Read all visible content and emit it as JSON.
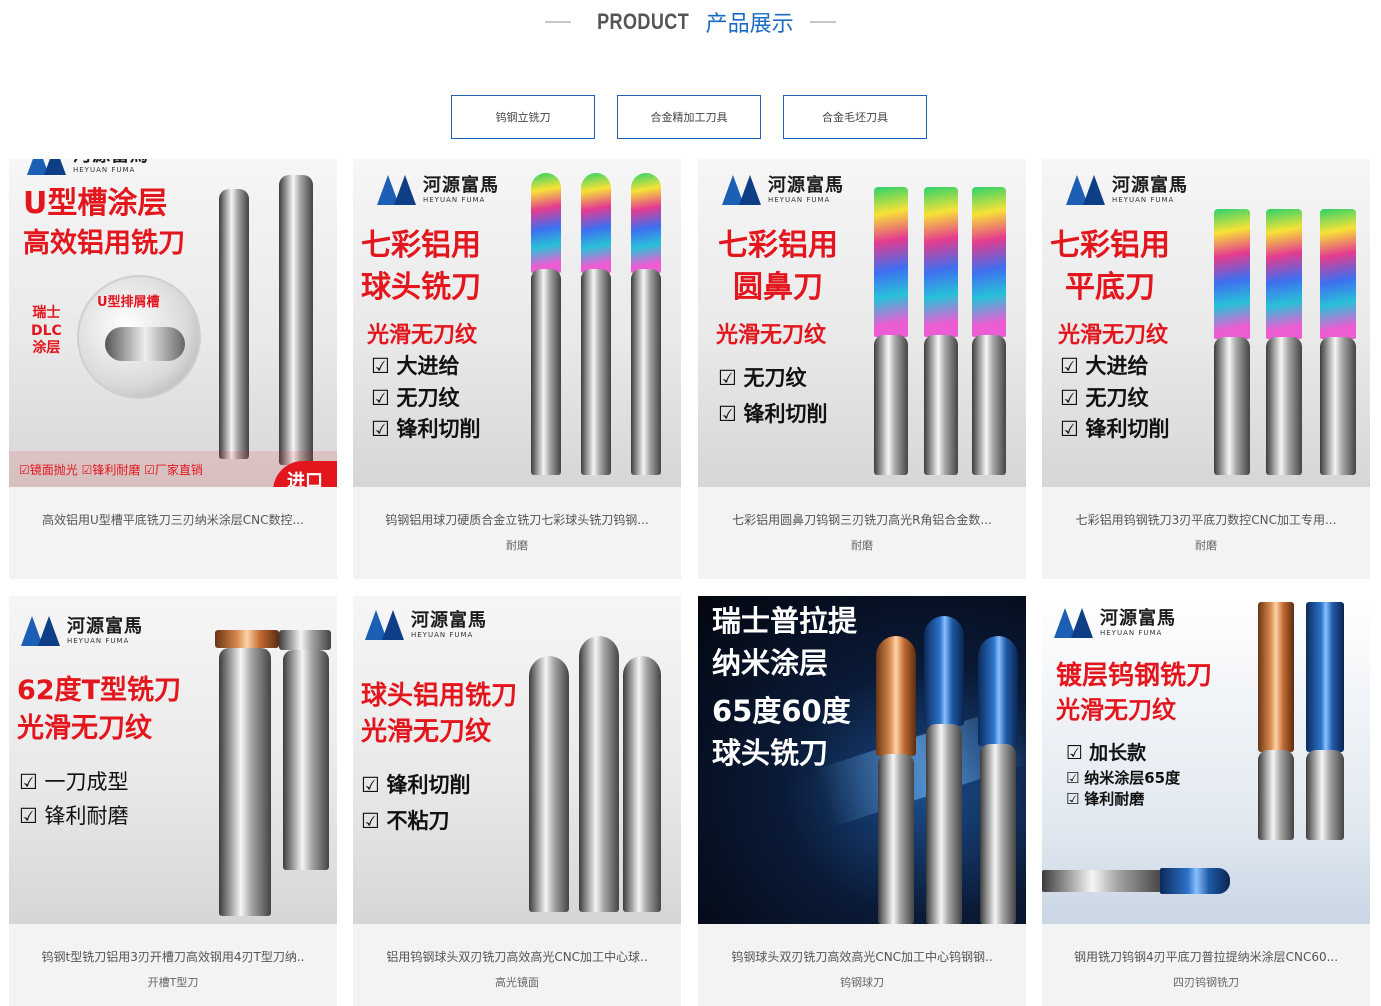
{
  "header": {
    "title_en": "PRODUCT",
    "title_cn": "产品展示"
  },
  "tabs": [
    "钨钢立铣刀",
    "合金精加工刀具",
    "合金毛坯刀具"
  ],
  "brand": {
    "cn": "河源富馬",
    "en": "HEYUAN FUMA"
  },
  "products": [
    {
      "title": "高效铝用U型槽平底铣刀三刃纳米涂层CNC数控...",
      "tag": "",
      "image": {
        "headline": [
          "U型槽涂层",
          "高效铝用铣刀"
        ],
        "callout": "U型排屑槽",
        "coating": [
          "瑞士",
          "DLC",
          "涂层"
        ],
        "footer": "☑镜面抛光 ☑锋利耐磨 ☑厂家直销",
        "corner": "进口"
      }
    },
    {
      "title": "钨钢铝用球刀硬质合金立铣刀七彩球头铣刀钨钢...",
      "tag": "耐磨",
      "image": {
        "headline": [
          "七彩铝用",
          "球头铣刀"
        ],
        "sub": "光滑无刀纹",
        "checks": [
          "大进给",
          "无刀纹",
          "锋利切削"
        ]
      }
    },
    {
      "title": "七彩铝用圆鼻刀钨钢三刃铣刀高光R角铝合金数...",
      "tag": "耐磨",
      "image": {
        "headline": [
          "七彩铝用",
          "圆鼻刀"
        ],
        "sub": "光滑无刀纹",
        "checks": [
          "无刀纹",
          "锋利切削"
        ]
      }
    },
    {
      "title": "七彩铝用钨钢铣刀3刃平底刀数控CNC加工专用...",
      "tag": "耐磨",
      "image": {
        "headline": [
          "七彩铝用",
          "平底刀"
        ],
        "sub": "光滑无刀纹",
        "checks": [
          "大进给",
          "无刀纹",
          "锋利切削"
        ]
      }
    },
    {
      "title": "钨钢t型铣刀铝用3刃开槽刀高效钢用4刃T型刀纳..",
      "tag": "开槽T型刀",
      "image": {
        "headline": [
          "62度T型铣刀",
          "光滑无刀纹"
        ],
        "checks": [
          "一刀成型",
          "锋利耐磨"
        ]
      }
    },
    {
      "title": "铝用钨钢球头双刃铣刀高效高光CNC加工中心球..",
      "tag": "高光镜面",
      "image": {
        "headline": [
          "球头铝用铣刀",
          "光滑无刀纹"
        ],
        "checks": [
          "锋利切削",
          "不粘刀"
        ]
      }
    },
    {
      "title": "钨钢球头双刃铣刀高效高光CNC加工中心钨钢钢..",
      "tag": "钨钢球刀",
      "image": {
        "headline": [
          "瑞士普拉提",
          "纳米涂层",
          "65度60度",
          "球头铣刀"
        ]
      }
    },
    {
      "title": "钢用铣刀钨钢4刃平底刀普拉提纳米涂层CNC60...",
      "tag": "四刃钨钢铣刀",
      "image": {
        "headline": [
          "镀层钨钢铣刀",
          "光滑无刀纹"
        ],
        "checks": [
          "加长款",
          "纳米涂层65度",
          "锋利耐磨"
        ]
      }
    }
  ],
  "colors": {
    "accent": "#1a6bc4",
    "tab_border": "#1f63b8",
    "promo_red": "#e4161d",
    "card_bg": "#f3f3f3"
  }
}
